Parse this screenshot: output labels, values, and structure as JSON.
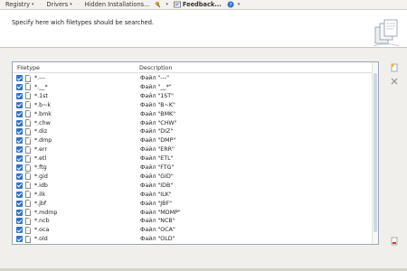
{
  "menu": {
    "items": [
      {
        "label": "Registry",
        "icon": "none"
      },
      {
        "label": "Drivers",
        "icon": "none"
      },
      {
        "label": "Hidden Installations...",
        "icon": "none"
      },
      {
        "label": "",
        "icon": "tools-icon"
      },
      {
        "label": "Feedback...",
        "icon": "feedback-icon"
      },
      {
        "label": "",
        "icon": "help-icon"
      }
    ]
  },
  "header": {
    "instruction": "Specify here wich filetypes should be searched.",
    "icon": "files-stack-icon"
  },
  "list": {
    "columns": {
      "filetype": "Filetype",
      "description": "Description"
    },
    "rows": [
      {
        "ext": "*.---",
        "desc": "Файл \"---\"",
        "checked": true
      },
      {
        "ext": "*.__*",
        "desc": "Файл \"__*\"",
        "checked": true
      },
      {
        "ext": "*.1st",
        "desc": "Файл \"1ST\"",
        "checked": true
      },
      {
        "ext": "*.b~k",
        "desc": "Файл \"B~K\"",
        "checked": true
      },
      {
        "ext": "*.bmk",
        "desc": "Файл \"BMK\"",
        "checked": true
      },
      {
        "ext": "*.chw",
        "desc": "Файл \"CHW\"",
        "checked": true
      },
      {
        "ext": "*.diz",
        "desc": "Файл \"DIZ\"",
        "checked": true
      },
      {
        "ext": "*.dmp",
        "desc": "Файл \"DMP\"",
        "checked": true
      },
      {
        "ext": "*.err",
        "desc": "Файл \"ERR\"",
        "checked": true
      },
      {
        "ext": "*.etl",
        "desc": "Файл \"ETL\"",
        "checked": true
      },
      {
        "ext": "*.ftg",
        "desc": "Файл \"FTG\"",
        "checked": true
      },
      {
        "ext": "*.gid",
        "desc": "Файл \"GID\"",
        "checked": true
      },
      {
        "ext": "*.idb",
        "desc": "Файл \"IDB\"",
        "checked": true
      },
      {
        "ext": "*.ilk",
        "desc": "Файл \"ILK\"",
        "checked": true
      },
      {
        "ext": "*.jbf",
        "desc": "Файл \"JBF\"",
        "checked": true
      },
      {
        "ext": "*.mdmp",
        "desc": "Файл \"MDMP\"",
        "checked": true
      },
      {
        "ext": "*.ncb",
        "desc": "Файл \"NCB\"",
        "checked": true
      },
      {
        "ext": "*.oca",
        "desc": "Файл \"OCA\"",
        "checked": true
      },
      {
        "ext": "*.old",
        "desc": "Файл \"OLD\"",
        "checked": true
      }
    ]
  },
  "side_buttons": {
    "add": "add-filetype-icon",
    "remove": "remove-filetype-icon",
    "restore": "restore-defaults-icon"
  },
  "colors": {
    "checkbox": "#2f72c9",
    "remove": "#9a9a9a",
    "accent_red": "#d23a1a"
  }
}
